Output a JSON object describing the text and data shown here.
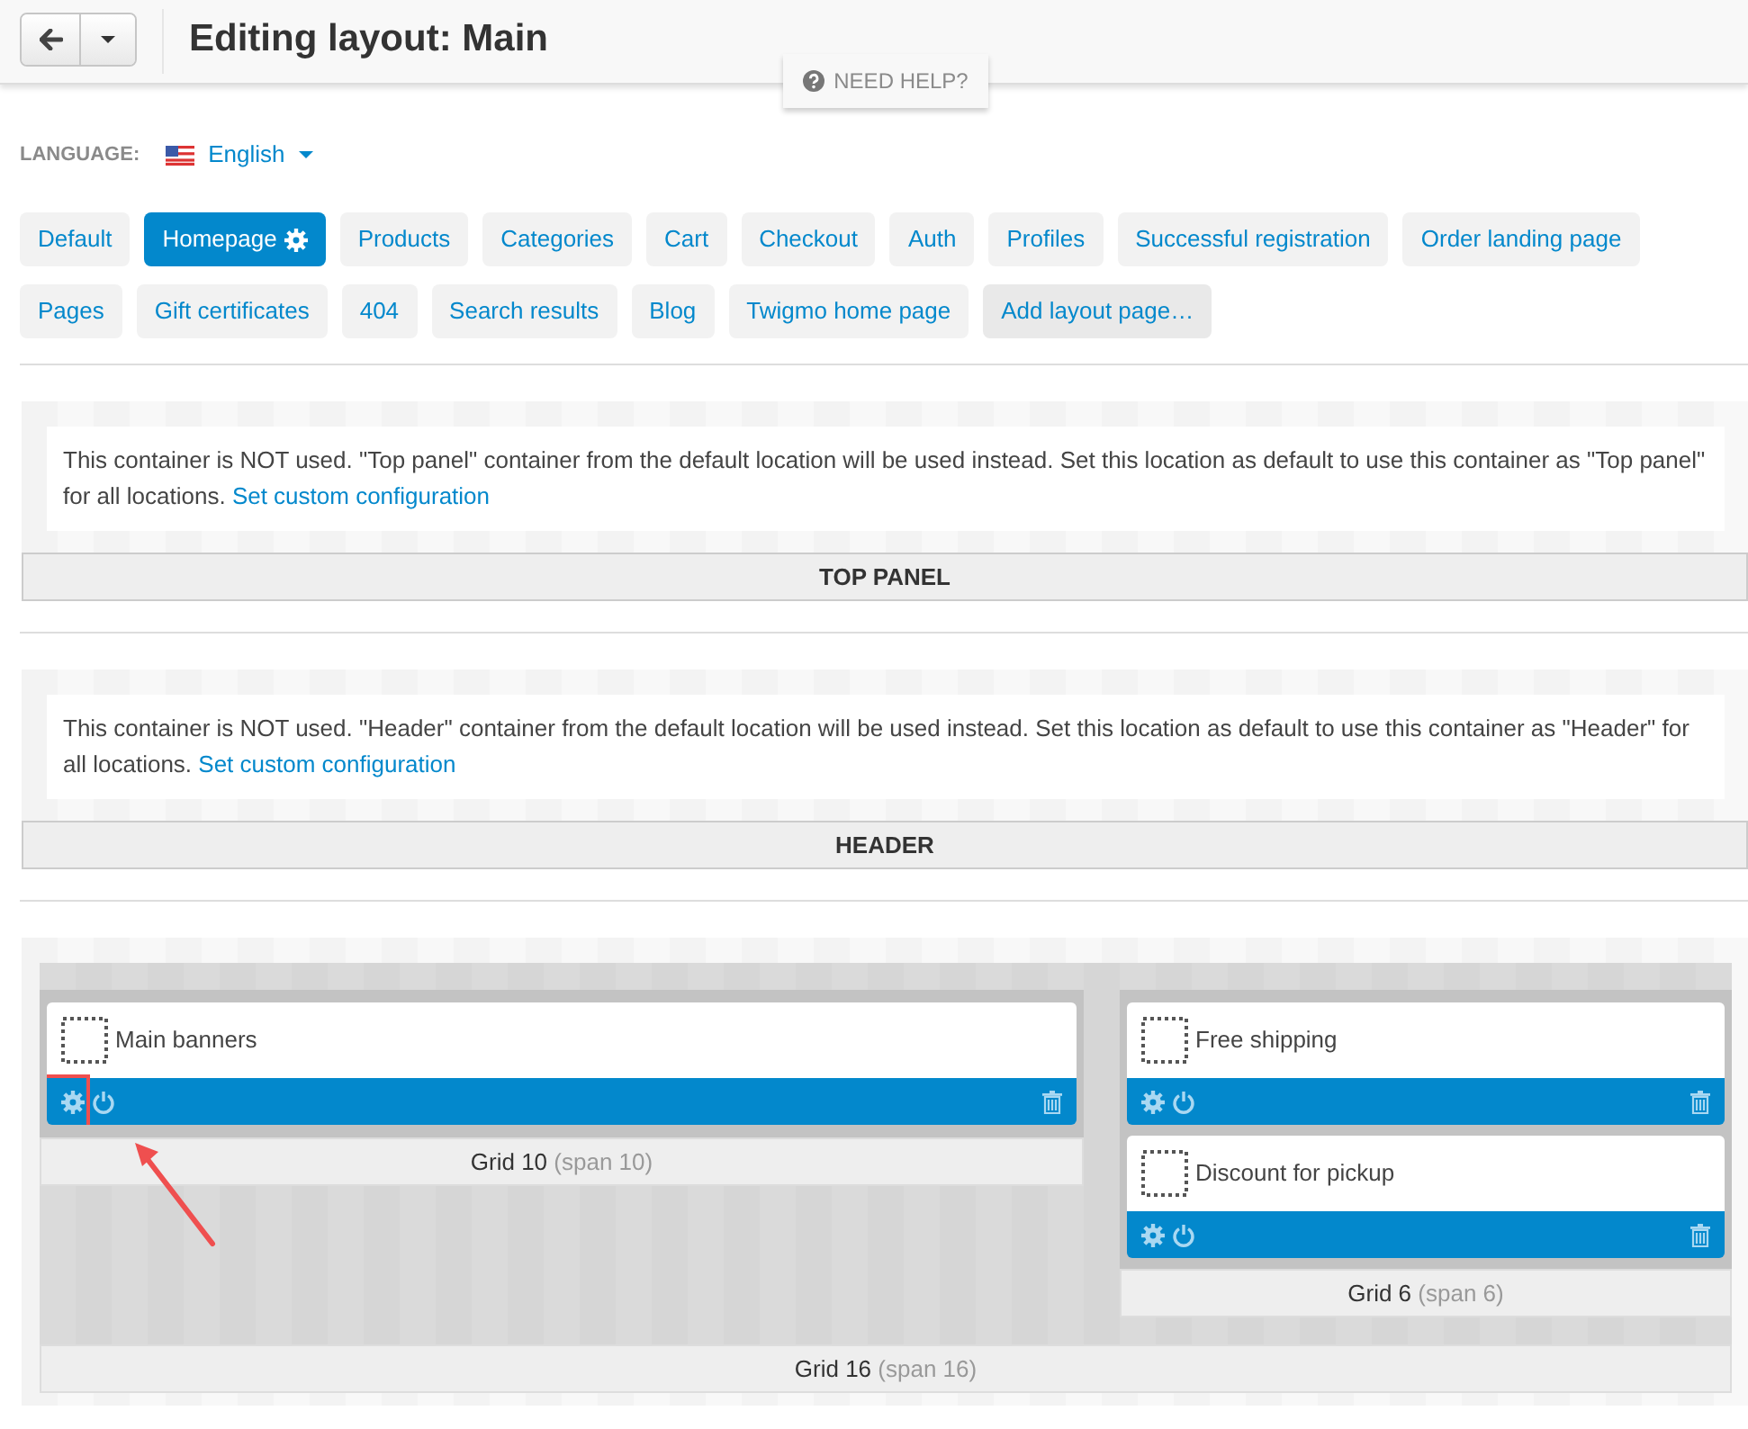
{
  "header": {
    "title": "Editing layout: Main",
    "help": "NEED HELP?"
  },
  "language": {
    "label": "LANGUAGE:",
    "value": "English"
  },
  "tabs": [
    {
      "label": "Default",
      "selected": false,
      "kind": "page"
    },
    {
      "label": "Homepage",
      "selected": true,
      "kind": "page"
    },
    {
      "label": "Products",
      "selected": false,
      "kind": "page"
    },
    {
      "label": "Categories",
      "selected": false,
      "kind": "page"
    },
    {
      "label": "Cart",
      "selected": false,
      "kind": "page"
    },
    {
      "label": "Checkout",
      "selected": false,
      "kind": "page"
    },
    {
      "label": "Auth",
      "selected": false,
      "kind": "page"
    },
    {
      "label": "Profiles",
      "selected": false,
      "kind": "page"
    },
    {
      "label": "Successful registration",
      "selected": false,
      "kind": "page"
    },
    {
      "label": "Order landing page",
      "selected": false,
      "kind": "page"
    },
    {
      "label": "Pages",
      "selected": false,
      "kind": "page"
    },
    {
      "label": "Gift certificates",
      "selected": false,
      "kind": "page"
    },
    {
      "label": "404",
      "selected": false,
      "kind": "page"
    },
    {
      "label": "Search results",
      "selected": false,
      "kind": "page"
    },
    {
      "label": "Blog",
      "selected": false,
      "kind": "page"
    },
    {
      "label": "Twigmo home page",
      "selected": false,
      "kind": "page"
    },
    {
      "label": "Add layout page…",
      "selected": false,
      "kind": "add"
    }
  ],
  "containers": [
    {
      "kind": "notice",
      "notice": "This container is NOT used. \"Top panel\" container from the default location will be used instead. Set this location as default to use this container as \"Top panel\" for all locations.",
      "link": "Set custom configuration",
      "title": "TOP PANEL"
    },
    {
      "kind": "notice",
      "notice": "This container is NOT used. \"Header\" container from the default location will be used instead. Set this location as default to use this container as \"Header\" for all locations.",
      "link": "Set custom configuration",
      "title": "HEADER"
    },
    {
      "kind": "grid",
      "label": "Grid 16",
      "span": "(span 16)",
      "columns": [
        {
          "label": "Grid 10",
          "span": "(span 10)",
          "blocks": [
            {
              "title": "Main banners",
              "highlighted": true
            }
          ]
        },
        {
          "label": "Grid 6",
          "span": "(span 6)",
          "blocks": [
            {
              "title": "Free shipping",
              "highlighted": false
            },
            {
              "title": "Discount for pickup",
              "highlighted": false
            }
          ]
        }
      ]
    }
  ]
}
